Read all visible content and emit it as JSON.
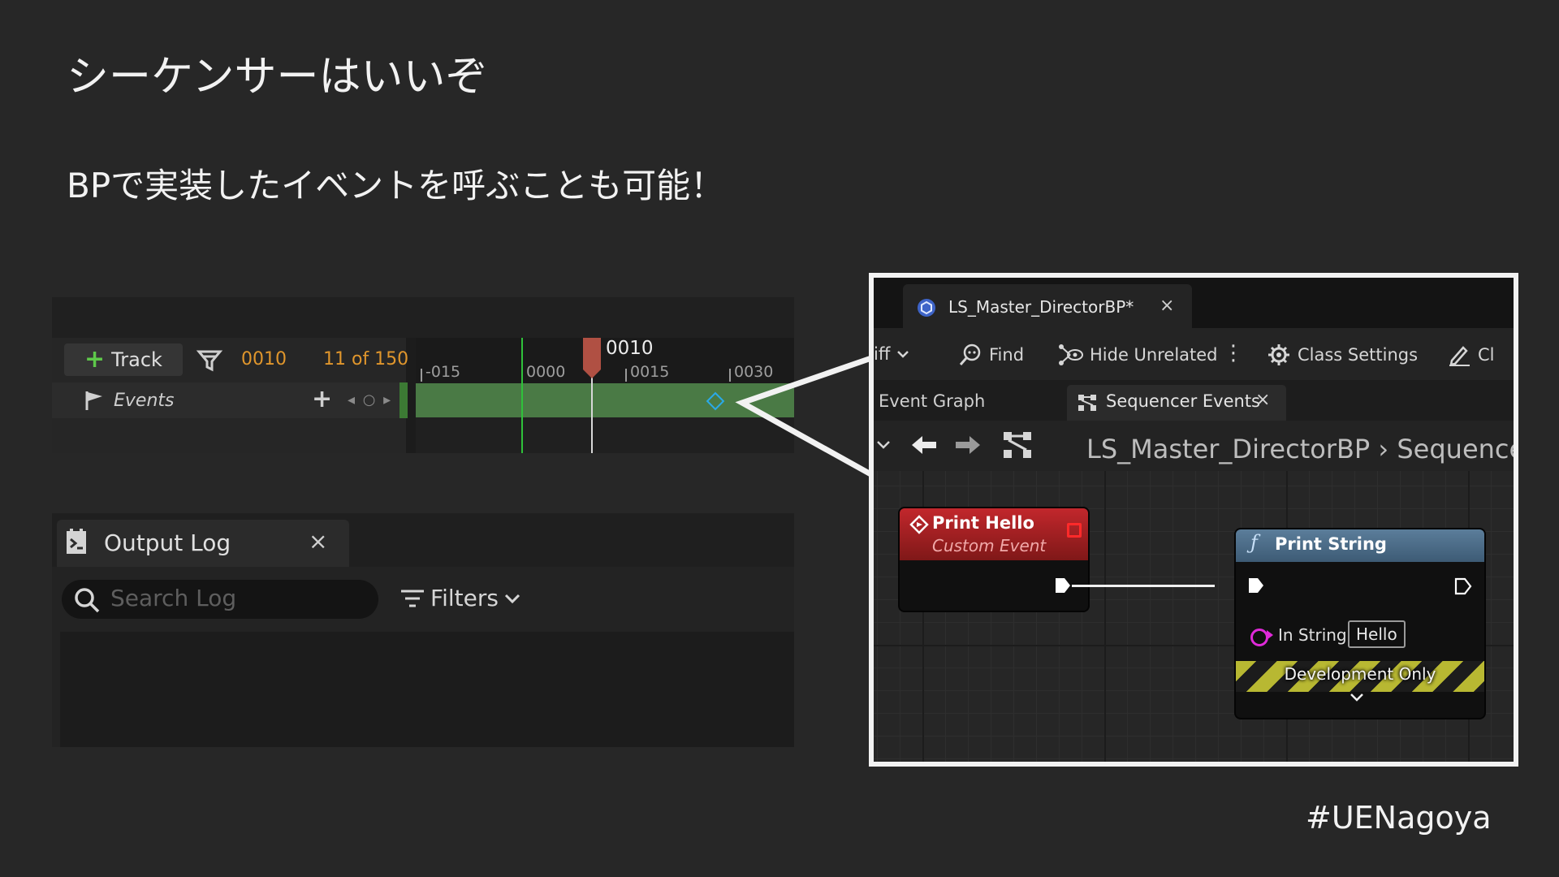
{
  "slide": {
    "title": "シーケンサーはいいぞ",
    "subtitle": "BPで実装したイベントを呼ぶことも可能！",
    "hashtag": "#UENagoya"
  },
  "sequencer": {
    "add_track_label": "Track",
    "current_frame": "0010",
    "frame_count": "11 of 150",
    "ruler_ticks": [
      "-015",
      "0000",
      "0015",
      "0030"
    ],
    "playhead_label": "0010",
    "track_name": "Events",
    "nav_glyphs": "◂ ○ ▸",
    "accent_color": "#e0962c"
  },
  "output_log": {
    "tab_title": "Output Log",
    "search_placeholder": "Search Log",
    "filters_label": "Filters"
  },
  "blueprint": {
    "tab_title": "LS_Master_DirectorBP*",
    "toolbar": {
      "diff_label": "iff",
      "find_label": "Find",
      "hide_unrelated_label": "Hide Unrelated",
      "class_settings_label": "Class Settings",
      "class_defaults_label": "Cl"
    },
    "graph_tabs": [
      "Event Graph",
      "Sequencer Events"
    ],
    "breadcrumb": [
      "LS_Master_DirectorBP",
      "Sequence"
    ],
    "custom_event_node": {
      "title": "Print Hello",
      "subtitle": "Custom Event",
      "color": "#c2272c"
    },
    "print_string_node": {
      "title": "Print String",
      "in_string_label": "In String",
      "in_string_value": "Hello",
      "dev_only_label": "Development Only",
      "color": "#5b7d9a"
    }
  }
}
